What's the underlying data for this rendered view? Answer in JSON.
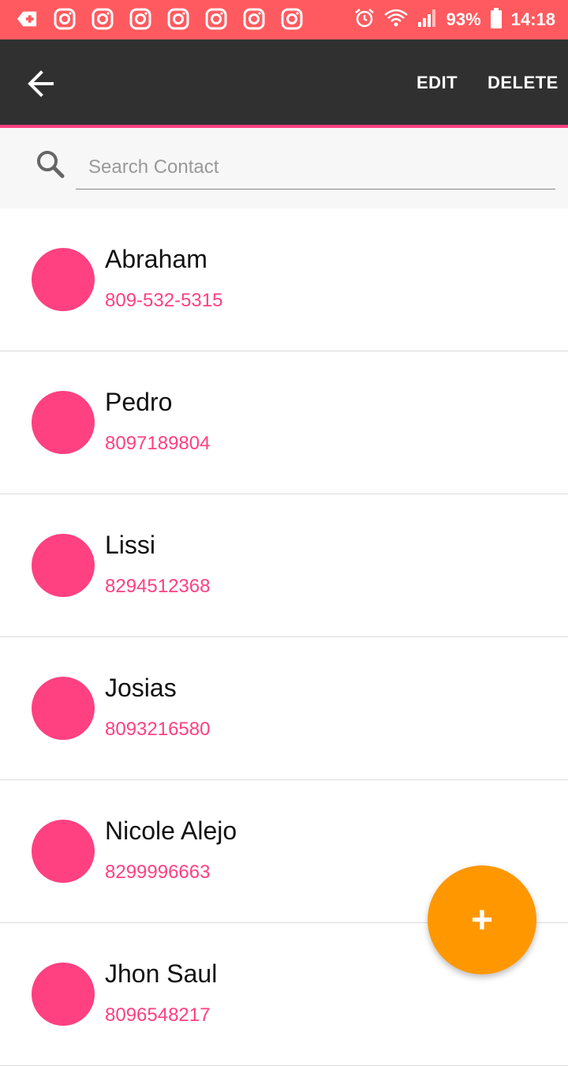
{
  "status_bar": {
    "battery": "93%",
    "time": "14:18",
    "color": "#ff5a5f",
    "icons_left": [
      "add-notification-icon",
      "instagram-icon",
      "instagram-icon",
      "instagram-icon",
      "instagram-icon",
      "instagram-icon",
      "instagram-icon",
      "instagram-icon"
    ],
    "icons_right": [
      "alarm-icon",
      "wifi-icon",
      "signal-icon",
      "battery-icon"
    ]
  },
  "toolbar": {
    "edit_label": "EDIT",
    "delete_label": "DELETE",
    "background": "#303030",
    "accent": "#ff3d7f"
  },
  "search": {
    "placeholder": "Search Contact",
    "value": ""
  },
  "contacts": [
    {
      "name": "Abraham",
      "phone": "809-532-5315"
    },
    {
      "name": "Pedro",
      "phone": "8097189804"
    },
    {
      "name": "Lissi",
      "phone": "8294512368"
    },
    {
      "name": "Josias",
      "phone": "8093216580"
    },
    {
      "name": "Nicole Alejo",
      "phone": "8299996663"
    },
    {
      "name": "Jhon Saul",
      "phone": "8096548217"
    }
  ],
  "fab": {
    "label": "+",
    "color": "#ff9800"
  },
  "colors": {
    "avatar": "#ff4081",
    "phone_text": "#ff4081"
  }
}
